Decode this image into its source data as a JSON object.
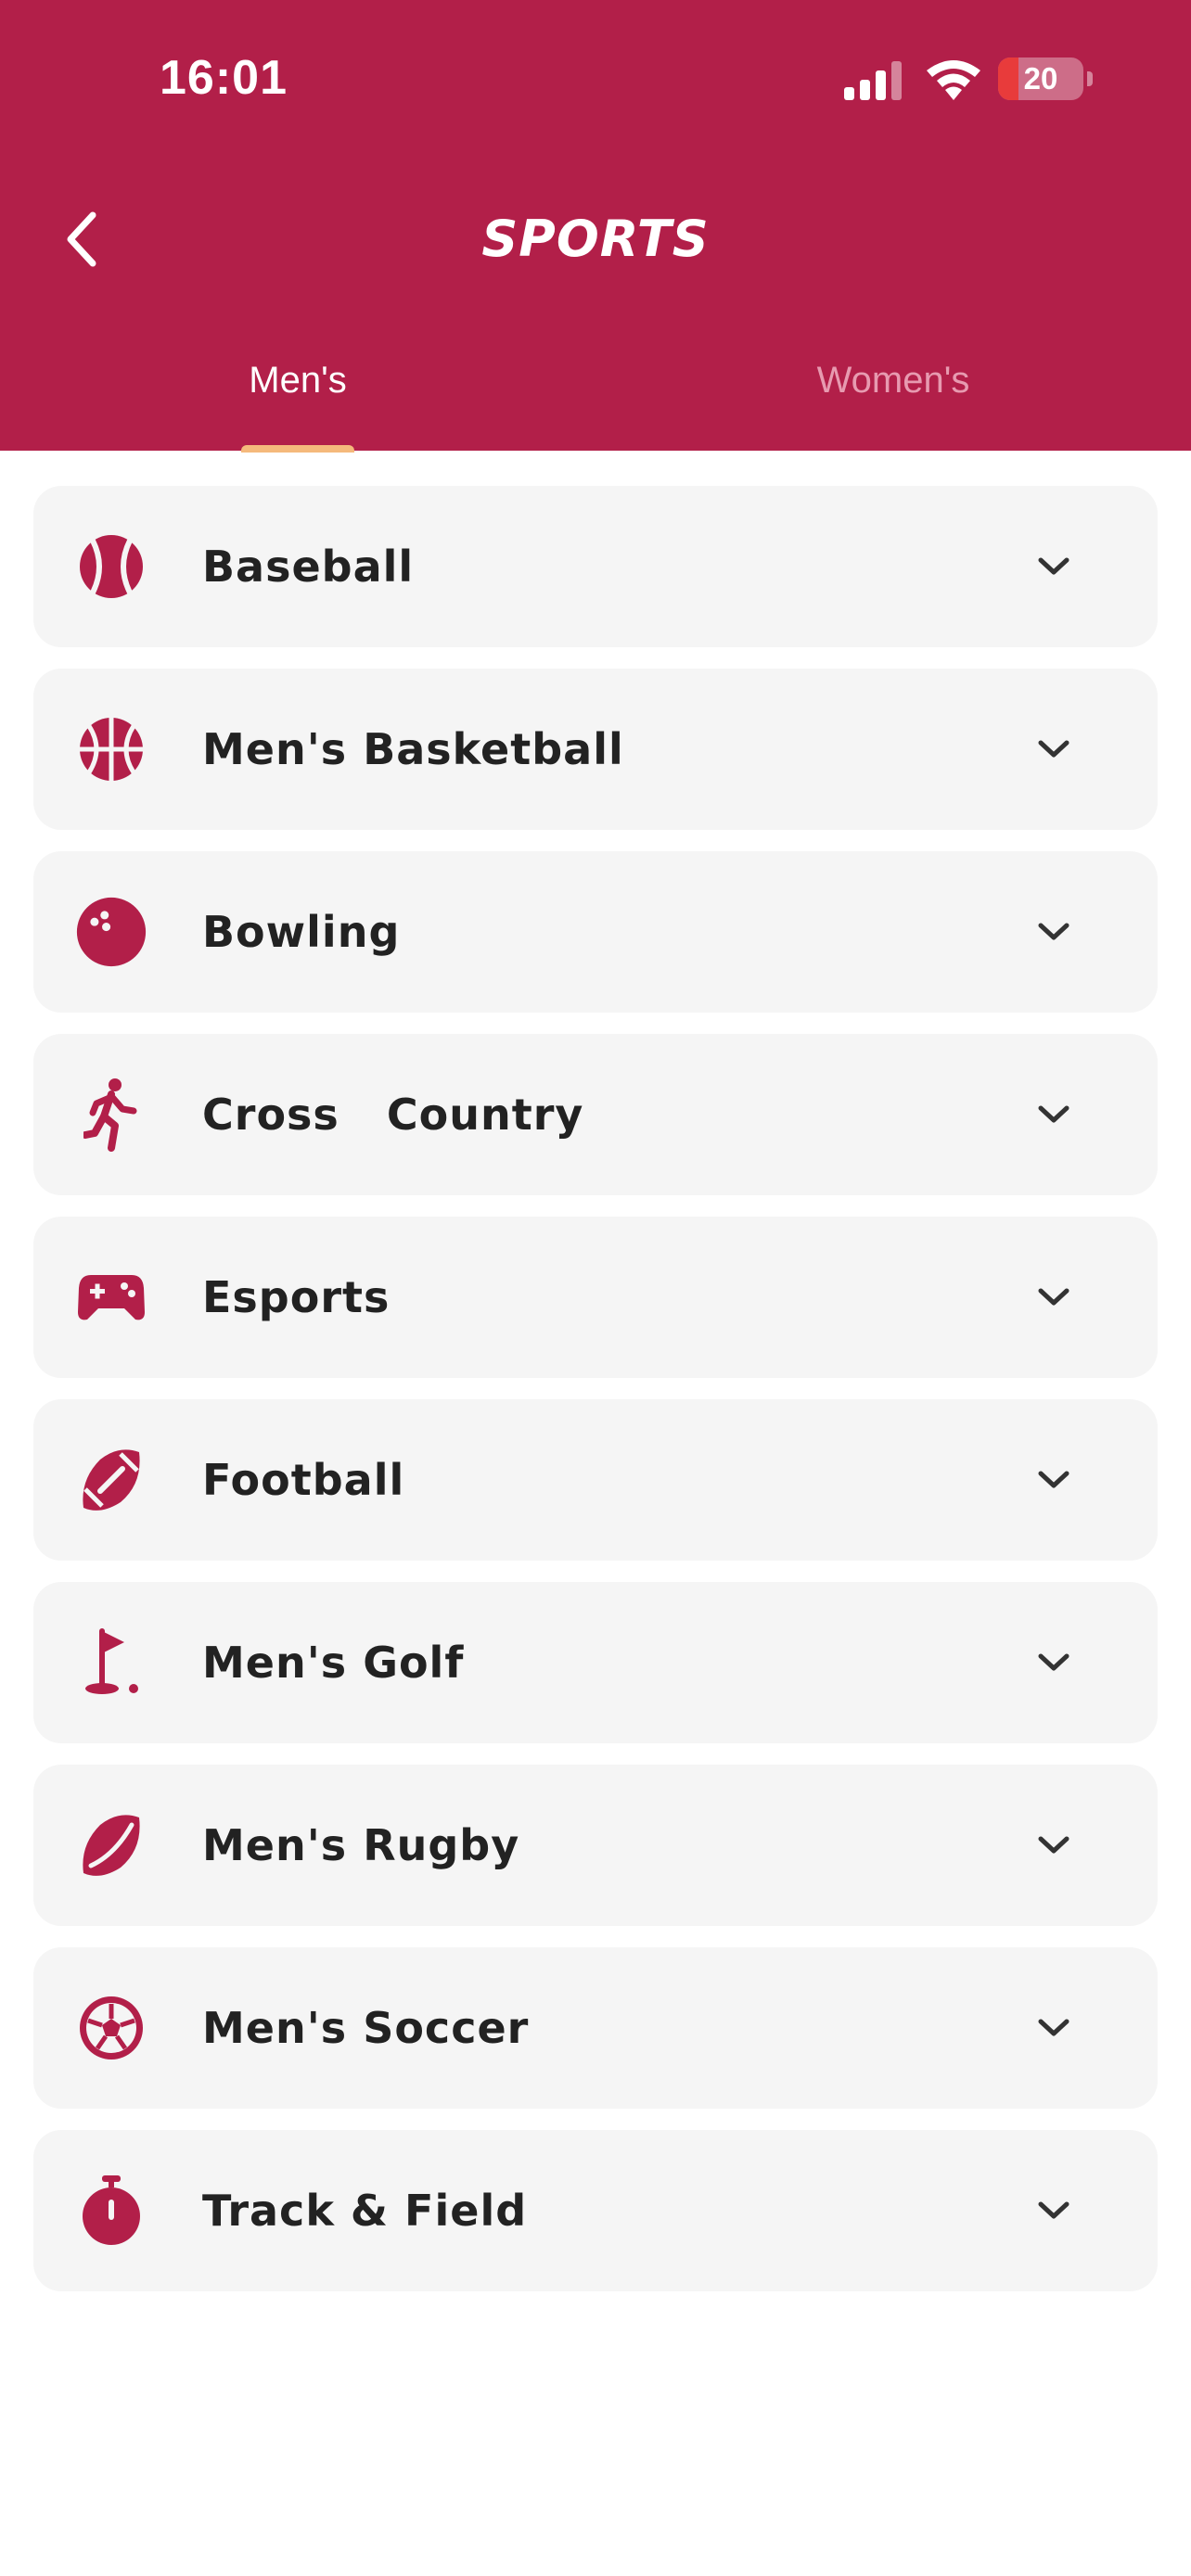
{
  "status_bar": {
    "time": "16:01",
    "battery": "20",
    "icons": [
      "signal-icon",
      "wifi-icon",
      "battery-icon"
    ]
  },
  "header": {
    "title": "SPORTS",
    "back_icon": "chevron-left-icon",
    "background_color": "#b21f49"
  },
  "tabs": [
    {
      "label": "Men's",
      "active": true
    },
    {
      "label": "Women's",
      "active": false
    }
  ],
  "colors": {
    "accent": "#b21f49",
    "tab_indicator": "#f5b97c",
    "item_background": "#f5f5f5",
    "text": "#222222"
  },
  "sports": [
    {
      "label": "Baseball",
      "icon": "baseball-icon"
    },
    {
      "label": "Men's Basketball",
      "icon": "basketball-icon"
    },
    {
      "label": "Bowling",
      "icon": "bowling-ball-icon"
    },
    {
      "label": "Cross   Country",
      "icon": "running-person-icon"
    },
    {
      "label": "Esports",
      "icon": "gamepad-icon"
    },
    {
      "label": "Football",
      "icon": "football-icon"
    },
    {
      "label": "Men's Golf",
      "icon": "golf-flag-icon"
    },
    {
      "label": "Men's Rugby",
      "icon": "rugby-ball-icon"
    },
    {
      "label": "Men's Soccer",
      "icon": "soccer-ball-icon"
    },
    {
      "label": "Track & Field",
      "icon": "stopwatch-icon"
    }
  ]
}
